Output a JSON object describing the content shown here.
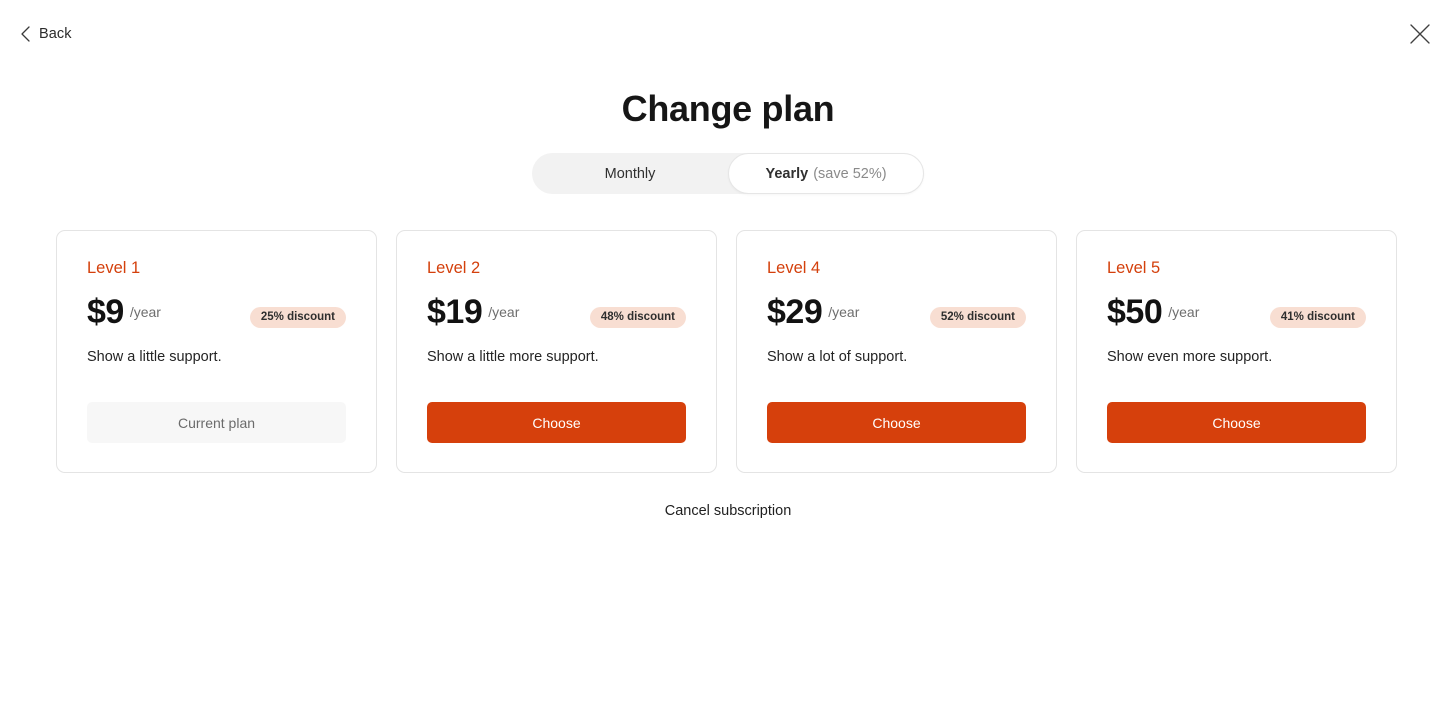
{
  "topbar": {
    "back_label": "Back",
    "back_icon": "chevron-left-icon",
    "close_icon": "close-icon"
  },
  "header": {
    "title": "Change plan"
  },
  "billing_toggle": {
    "options": [
      {
        "label": "Monthly",
        "sub": "",
        "selected": false
      },
      {
        "label": "Yearly",
        "sub": "(save 52%)",
        "selected": true
      }
    ]
  },
  "plans": [
    {
      "level": "Level 1",
      "price": "$9",
      "period": "/year",
      "discount": "25% discount",
      "description": "Show a little support.",
      "action_label": "Current plan",
      "is_current": true
    },
    {
      "level": "Level 2",
      "price": "$19",
      "period": "/year",
      "discount": "48% discount",
      "description": "Show a little more support.",
      "action_label": "Choose",
      "is_current": false
    },
    {
      "level": "Level 4",
      "price": "$29",
      "period": "/year",
      "discount": "52% discount",
      "description": "Show a lot of support.",
      "action_label": "Choose",
      "is_current": false
    },
    {
      "level": "Level 5",
      "price": "$50",
      "period": "/year",
      "discount": "41% discount",
      "description": "Show even more support.",
      "action_label": "Choose",
      "is_current": false
    }
  ],
  "footer": {
    "cancel_label": "Cancel subscription"
  },
  "colors": {
    "accent": "#d6400c",
    "level_text": "#d4400c",
    "badge_bg": "#f8ded2",
    "toggle_track": "#f2f2f2",
    "card_border": "#e4e4e4",
    "current_plan_bg": "#f7f7f7",
    "page_bg": "#ffffff"
  }
}
